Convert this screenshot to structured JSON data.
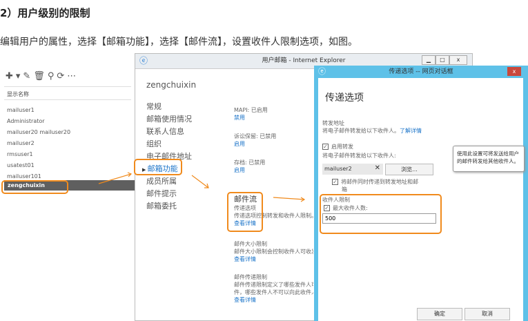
{
  "heading": "2）用户级别的限制",
  "intro": "编辑用户的属性，选择【邮箱功能】，选择【邮件流】，设置收件人限制选项，如图。",
  "left_panel": {
    "toolbar_icons": [
      "plus-icon",
      "pencil-icon",
      "trash-icon",
      "search-icon",
      "refresh-icon",
      "more-icon"
    ],
    "column_header": "显示名称",
    "users": [
      "mailuser1",
      "Administrator",
      "mailuser20 mailuser20",
      "mailuser2",
      "rmsuser1",
      "usatest01",
      "mailuser101"
    ],
    "selected_user": "zengchuixin"
  },
  "ie_window": {
    "title": "用户邮箱 - Internet Explorer",
    "user_name": "zengchuixin",
    "nav": [
      "常规",
      "邮箱使用情况",
      "联系人信息",
      "组织",
      "电子邮件地址",
      "邮箱功能",
      "成员所属",
      "邮件提示",
      "邮箱委托"
    ],
    "active_nav": "邮箱功能",
    "features": [
      {
        "label": "MAPI: 已启用",
        "link": "禁用"
      },
      {
        "label": "诉讼保留: 已禁用",
        "link": "启用"
      },
      {
        "label": "存档: 已禁用",
        "link": "启用"
      }
    ],
    "mail_flow": {
      "title": "邮件流",
      "sub": "传递选项",
      "desc": "传递选项控制转发和收件人限制。",
      "link": "查看详情"
    },
    "size_limit": {
      "title": "邮件大小限制",
      "desc": "邮件大小限制会控制收件人可收发",
      "link": "查看详情"
    },
    "delivery_limit": {
      "title": "邮件传递限制",
      "desc1": "邮件传递限制定义了哪些发件人可",
      "desc2": "件，哪些发件人不可以向此收件人",
      "link": "查看详情"
    }
  },
  "dialog": {
    "title": "传递选项 -- 网页对话框",
    "heading": "传递选项",
    "forward_label": "转发地址",
    "forward_desc": "将电子邮件转发给以下收件人。",
    "learn_more": "了解详情",
    "enable_forward": "启用转发",
    "enable_forward_checked": true,
    "forward_to": "将电子邮件转发给以下收件人:",
    "recipient": "mailuser2",
    "browse": "浏览...",
    "deliver_both": "将邮件同时传递到转发地址和邮",
    "deliver_both2": "箱",
    "deliver_both_checked": true,
    "tooltip": "使用此设置可将发送给用户的邮件转发给其他收件人。",
    "recipient_limit_label": "收件人限制",
    "max_recipients_label": "最大收件人数:",
    "max_recipients_checked": true,
    "max_recipients": "500",
    "ok": "确定",
    "cancel": "取消"
  },
  "colors": {
    "highlight": "#f08a1c",
    "dialog_frame": "#5ec1e8",
    "link": "#1a73c8"
  }
}
